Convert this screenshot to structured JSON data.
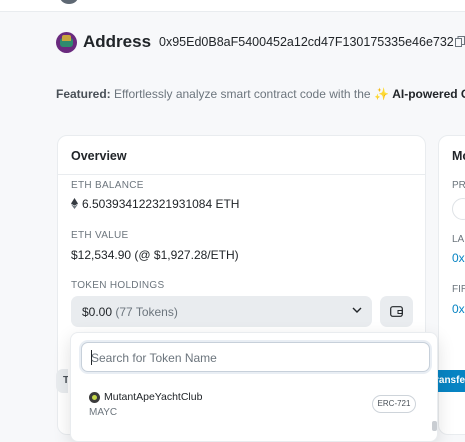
{
  "address": {
    "label": "Address",
    "hash": "0x95Ed0B8aF5400452a12cd47F130175335e46e732"
  },
  "featured": {
    "prefix": "Featured:",
    "text": "Effortlessly analyze smart contract code with the",
    "sparkle": "✨",
    "highlight": "AI-powered C"
  },
  "overview": {
    "title": "Overview",
    "eth_balance_label": "ETH BALANCE",
    "eth_balance_value": "6.503934122321931084 ETH",
    "eth_value_label": "ETH VALUE",
    "eth_value_value": "$12,534.90 (@ $1,927.28/ETH)",
    "token_holdings_label": "TOKEN HOLDINGS",
    "token_value": "$0.00",
    "token_count": "(77 Tokens)"
  },
  "more_info": {
    "title": "Mo",
    "private_label": "PR",
    "last_label": "LA",
    "last_link": "0x",
    "first_label": "FIR",
    "first_link": "0x"
  },
  "tabs": {
    "first_partial": "T"
  },
  "transfer_button": "ransfe",
  "dropdown": {
    "search_placeholder": "Search for Token Name",
    "tokens": [
      {
        "name": "MutantApeYachtClub",
        "symbol": "MAYC",
        "standard": "ERC-721"
      }
    ]
  },
  "colors": {
    "link": "#0784c3",
    "card_border": "#e9ecef",
    "select_bg": "#e9ecef"
  }
}
